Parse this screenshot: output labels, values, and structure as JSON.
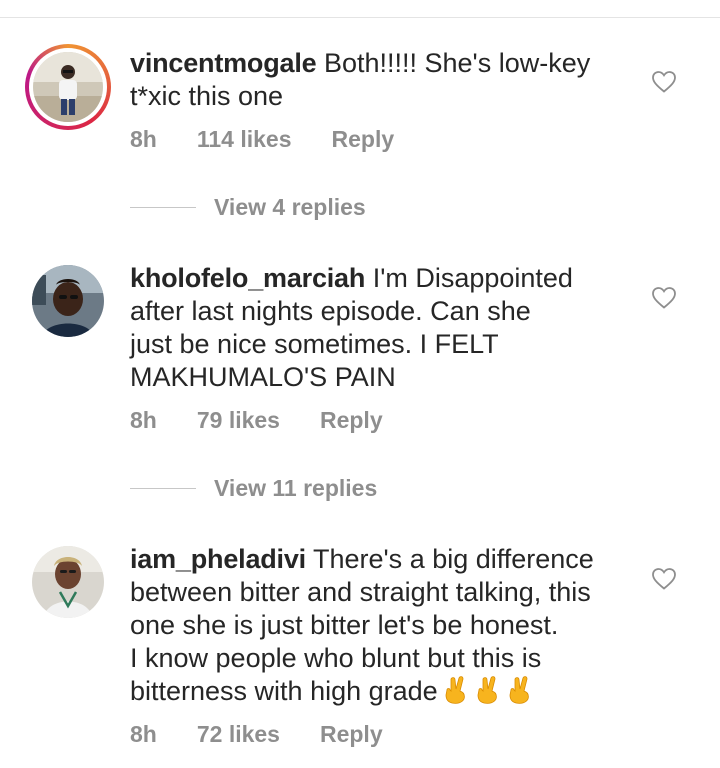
{
  "comments": [
    {
      "username": "vincentmogale",
      "text_lines": [
        "Both!!!!! She's low-key",
        "t*xic this one"
      ],
      "time": "8h",
      "likes": "114 likes",
      "reply": "Reply",
      "view_replies": "View 4 replies",
      "avatar_ring": true
    },
    {
      "username": "kholofelo_marciah",
      "text_lines": [
        "I'm Disappointed",
        "after last nights episode. Can she",
        "just be nice sometimes. I FELT",
        "MAKHUMALO'S PAIN"
      ],
      "time": "8h",
      "likes": "79 likes",
      "reply": "Reply",
      "view_replies": "View 11 replies",
      "avatar_ring": false
    },
    {
      "username": "iam_pheladivi",
      "text_lines": [
        "There's a big difference",
        "between bitter and straight talking, this",
        "one she is just bitter let's be honest.",
        "I know people who blunt but this is",
        "bitterness with high grade"
      ],
      "emoji": "crossed-fingers-icon x3",
      "time": "8h",
      "likes": "72 likes",
      "reply": "Reply",
      "avatar_ring": false
    }
  ],
  "colors": {
    "text": "#262626",
    "muted": "#8e8e8e",
    "divider": "#e4e4e4"
  }
}
